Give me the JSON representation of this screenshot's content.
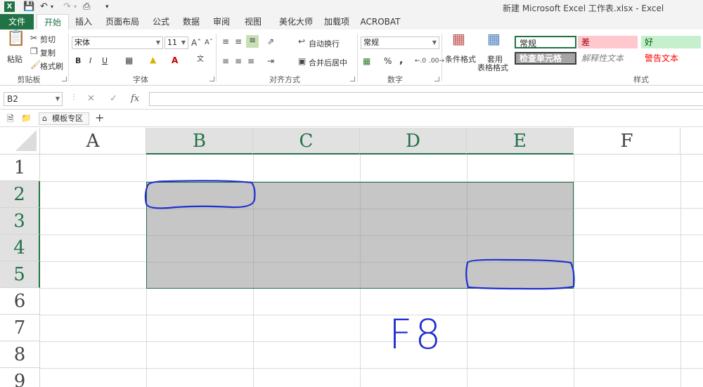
{
  "window": {
    "title": "新建 Microsoft Excel 工作表.xlsx - Excel",
    "app_logo": "X"
  },
  "tabs": [
    "文件",
    "开始",
    "插入",
    "页面布局",
    "公式",
    "数据",
    "审阅",
    "视图",
    "美化大师",
    "加载项",
    "ACROBAT"
  ],
  "active_tab": "开始",
  "ribbon": {
    "clipboard": {
      "paste": "粘贴",
      "cut": "剪切",
      "copy": "复制",
      "format_painter": "格式刷",
      "label": "剪贴板"
    },
    "font": {
      "name": "宋体",
      "size": "11",
      "bold": "B",
      "italic": "I",
      "underline": "U",
      "label": "字体"
    },
    "alignment": {
      "wrap": "自动换行",
      "merge": "合并后居中",
      "label": "对齐方式"
    },
    "number": {
      "format": "常规",
      "percent": "%",
      "comma": ",",
      "label": "数字"
    },
    "styles": {
      "conditional": "条件格式",
      "table_line1": "套用",
      "table_line2": "表格格式",
      "label": "样式",
      "cells": [
        {
          "text": "常规",
          "color": "#000000",
          "bg": "#ffffff"
        },
        {
          "text": "差",
          "color": "#9c0006",
          "bg": "#ffc7ce"
        },
        {
          "text": "好",
          "color": "#006100",
          "bg": "#c6efce"
        },
        {
          "text": "检查单元格",
          "color": "#ffffff",
          "bg": "#a5a5a5"
        },
        {
          "text": "解释性文本",
          "color": "#7f7f7f",
          "bg": "#ffffff"
        },
        {
          "text": "警告文本",
          "color": "#ff0000",
          "bg": "#ffffff"
        }
      ]
    }
  },
  "formula_bar": {
    "name_box": "B2",
    "cancel": "✕",
    "enter": "✓",
    "fx": "fx",
    "value": ""
  },
  "template_tab": "模板专区",
  "grid": {
    "columns": [
      "A",
      "B",
      "C",
      "D",
      "E",
      "F"
    ],
    "selected_columns": [
      "B",
      "C",
      "D",
      "E"
    ],
    "rows": [
      "1",
      "2",
      "3",
      "4",
      "5",
      "6",
      "7",
      "8",
      "9"
    ],
    "selected_rows": [
      "2",
      "3",
      "4",
      "5"
    ],
    "selection": "B2:E5",
    "accent": "#217346"
  },
  "annotation": {
    "text": "F8"
  }
}
